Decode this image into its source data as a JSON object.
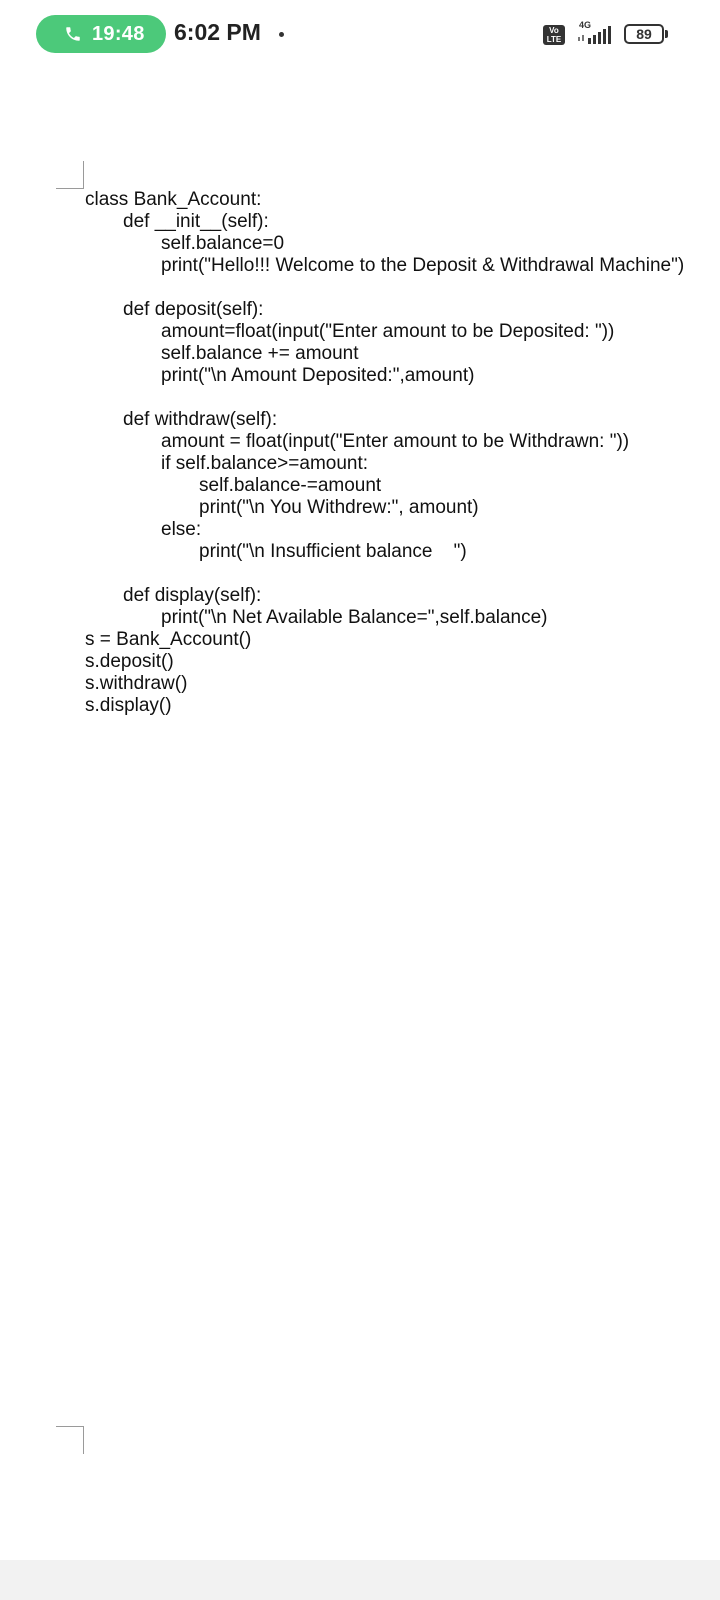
{
  "status_bar": {
    "call_time": "19:48",
    "clock": "6:02 PM",
    "volte_label": "Vo LTE",
    "network_type": "4G",
    "battery_level": "89"
  },
  "document": {
    "code_lines": [
      {
        "text": "class Bank_Account:",
        "indent": 0
      },
      {
        "text": "def __init__(self):",
        "indent": 1
      },
      {
        "text": "self.balance=0",
        "indent": 2
      },
      {
        "text": "print(\"Hello!!! Welcome to the Deposit & Withdrawal Machine\")",
        "indent": 2
      },
      {
        "text": "",
        "indent": 0
      },
      {
        "text": "def deposit(self):",
        "indent": 1
      },
      {
        "text": "amount=float(input(\"Enter amount to be Deposited: \"))",
        "indent": 2
      },
      {
        "text": "self.balance += amount",
        "indent": 2
      },
      {
        "text": "print(\"\\n Amount Deposited:\",amount)",
        "indent": 2
      },
      {
        "text": "",
        "indent": 0
      },
      {
        "text": "def withdraw(self):",
        "indent": 1
      },
      {
        "text": "amount = float(input(\"Enter amount to be Withdrawn: \"))",
        "indent": 2
      },
      {
        "text": "if self.balance>=amount:",
        "indent": 2
      },
      {
        "text": "self.balance-=amount",
        "indent": 3
      },
      {
        "text": "print(\"\\n You Withdrew:\", amount)",
        "indent": 3
      },
      {
        "text": "else:",
        "indent": 2
      },
      {
        "text": "print(\"\\n Insufficient balance    \")",
        "indent": 3
      },
      {
        "text": "",
        "indent": 0
      },
      {
        "text": "def display(self):",
        "indent": 1
      },
      {
        "text": "print(\"\\n Net Available Balance=\",self.balance)",
        "indent": 2
      },
      {
        "text": "s = Bank_Account()",
        "indent": 0
      },
      {
        "text": "s.deposit()",
        "indent": 0
      },
      {
        "text": "s.withdraw()",
        "indent": 0
      },
      {
        "text": "s.display()",
        "indent": 0
      }
    ]
  },
  "colors": {
    "call_pill": "#4cc97a",
    "text": "#111111",
    "page_background": "#ffffff"
  }
}
